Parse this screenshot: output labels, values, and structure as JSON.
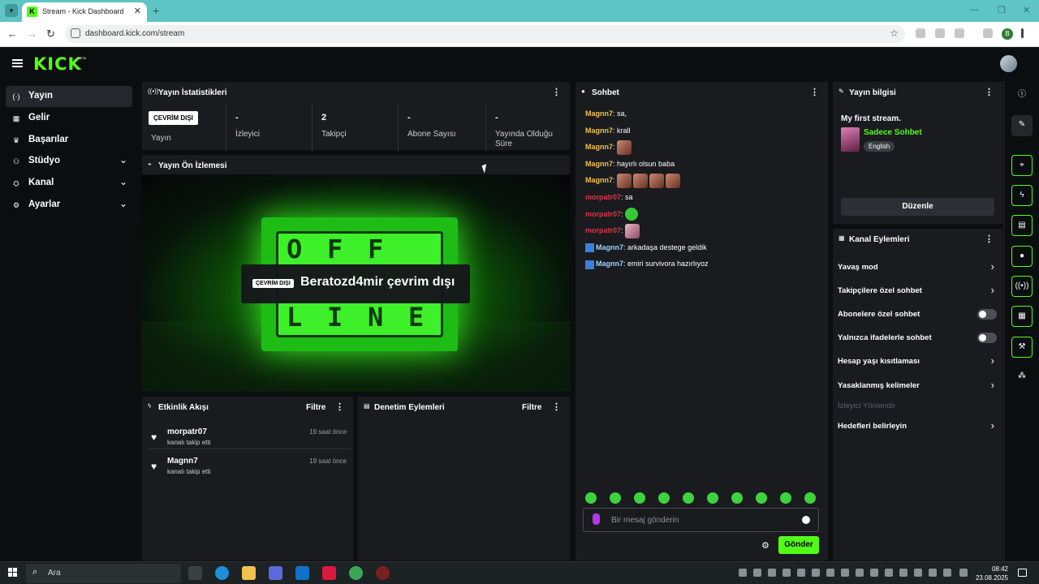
{
  "browser": {
    "tab_title": "Stream - Kick Dashboard",
    "tab_favicon": "K",
    "url": "dashboard.kick.com/stream",
    "profile_initial": "B"
  },
  "header": {
    "logo": "KICK",
    "logo_badge": "BETA"
  },
  "sidebar": {
    "items": [
      {
        "label": "Yayın",
        "icon": "broadcast-icon",
        "glyph": "(·)",
        "active": true,
        "expandable": false
      },
      {
        "label": "Gelir",
        "icon": "revenue-icon",
        "glyph": "▦",
        "active": false,
        "expandable": false
      },
      {
        "label": "Başarılar",
        "icon": "trophy-icon",
        "glyph": "♛",
        "active": false,
        "expandable": false
      },
      {
        "label": "Stüdyo",
        "icon": "studio-icon",
        "glyph": "⚇",
        "active": false,
        "expandable": true
      },
      {
        "label": "Kanal",
        "icon": "channel-icon",
        "glyph": "⛭",
        "active": false,
        "expandable": true
      },
      {
        "label": "Ayarlar",
        "icon": "settings-icon",
        "glyph": "⚙",
        "active": false,
        "expandable": true
      }
    ]
  },
  "stats": {
    "title": "Yayın İstatistikleri",
    "offline_badge": "ÇEVRİM DIŞI",
    "items": [
      {
        "value": "",
        "label": "Yayın"
      },
      {
        "value": "-",
        "label": "İzleyici"
      },
      {
        "value": "2",
        "label": "Takipçi"
      },
      {
        "value": "-",
        "label": "Abone Sayısı"
      },
      {
        "value": "-",
        "label": "Yayında Olduğu Süre"
      }
    ]
  },
  "preview": {
    "title": "Yayın Ön İzlemesi",
    "offline_badge": "ÇEVRİM DIŞI",
    "offline_text": "Beratozd4mir çevrim dışı",
    "tv_letters": [
      "O",
      "F",
      "F",
      "L",
      "I",
      "N",
      "E"
    ]
  },
  "activity": {
    "title": "Etkinlik Akışı",
    "filter": "Filtre",
    "events": [
      {
        "name": "morpatr07",
        "action": "kanalı takip etti",
        "time": "19 saat önce"
      },
      {
        "name": "Magnn7",
        "action": "kanalı takip etti",
        "time": "19 saat önce"
      }
    ]
  },
  "moderation": {
    "title": "Denetim Eylemleri",
    "filter": "Filtre"
  },
  "chat": {
    "title": "Sohbet",
    "messages": [
      {
        "user": "Magnn7",
        "color": "#f0c24a",
        "text": "sa,",
        "emotes": 0,
        "badge": false
      },
      {
        "user": "Magnn7",
        "color": "#f0c24a",
        "text": "krall",
        "emotes": 0,
        "badge": false
      },
      {
        "user": "Magnn7",
        "color": "#f0c24a",
        "text": "",
        "emotes": 1,
        "badge": false
      },
      {
        "user": "Magnn7",
        "color": "#f0c24a",
        "text": "hayırlı olsun baba",
        "emotes": 0,
        "badge": false
      },
      {
        "user": "Magnn7",
        "color": "#f0c24a",
        "text": "",
        "emotes": 4,
        "badge": false
      },
      {
        "user": "morpatr07",
        "color": "#e0334a",
        "text": "sa",
        "emotes": 0,
        "badge": false
      },
      {
        "user": "morpatr07",
        "color": "#e0334a",
        "text": "",
        "emotes": 1,
        "emote_style": "green",
        "badge": false
      },
      {
        "user": "morpatr07",
        "color": "#e0334a",
        "text": "",
        "emotes": 1,
        "emote_style": "pink",
        "badge": false
      },
      {
        "user": "Magnn7",
        "color": "#9fd3ff",
        "text": "arkadaşa destege geldik",
        "emotes": 0,
        "badge": true
      },
      {
        "user": "Magnn7",
        "color": "#9fd3ff",
        "text": "emiri survivora hazırlıyoz",
        "emotes": 0,
        "badge": true
      }
    ],
    "input_placeholder": "Bir mesaj gönderin",
    "send_label": "Gönder"
  },
  "stream_info": {
    "title": "Yayın bilgisi",
    "stream_title": "My first stream.",
    "category": "Sadece Sohbet",
    "language": "English",
    "edit_label": "Düzenle"
  },
  "channel_actions": {
    "title": "Kanal Eylemleri",
    "items": [
      {
        "label": "Yavaş mod",
        "control": "chevron"
      },
      {
        "label": "Takipçilere özel sohbet",
        "control": "chevron"
      },
      {
        "label": "Abonelere özel sohbet",
        "control": "toggle"
      },
      {
        "label": "Yalnızca ifadelerle sohbet",
        "control": "toggle"
      },
      {
        "label": "Hesap yaşı kısıtlaması",
        "control": "chevron"
      },
      {
        "label": "Yasaklanmış kelimeler",
        "control": "chevron"
      },
      {
        "label": "İzleyici Yönlendir",
        "control": "none",
        "disabled": true
      },
      {
        "label": "Hedefleri belirleyin",
        "control": "chevron"
      }
    ]
  },
  "taskbar": {
    "search_placeholder": "Ara",
    "time": "08:42",
    "date": "23.08.2025"
  },
  "colors": {
    "accent": "#53fc18",
    "panel": "#191b1f",
    "background": "#0b0e0f"
  }
}
